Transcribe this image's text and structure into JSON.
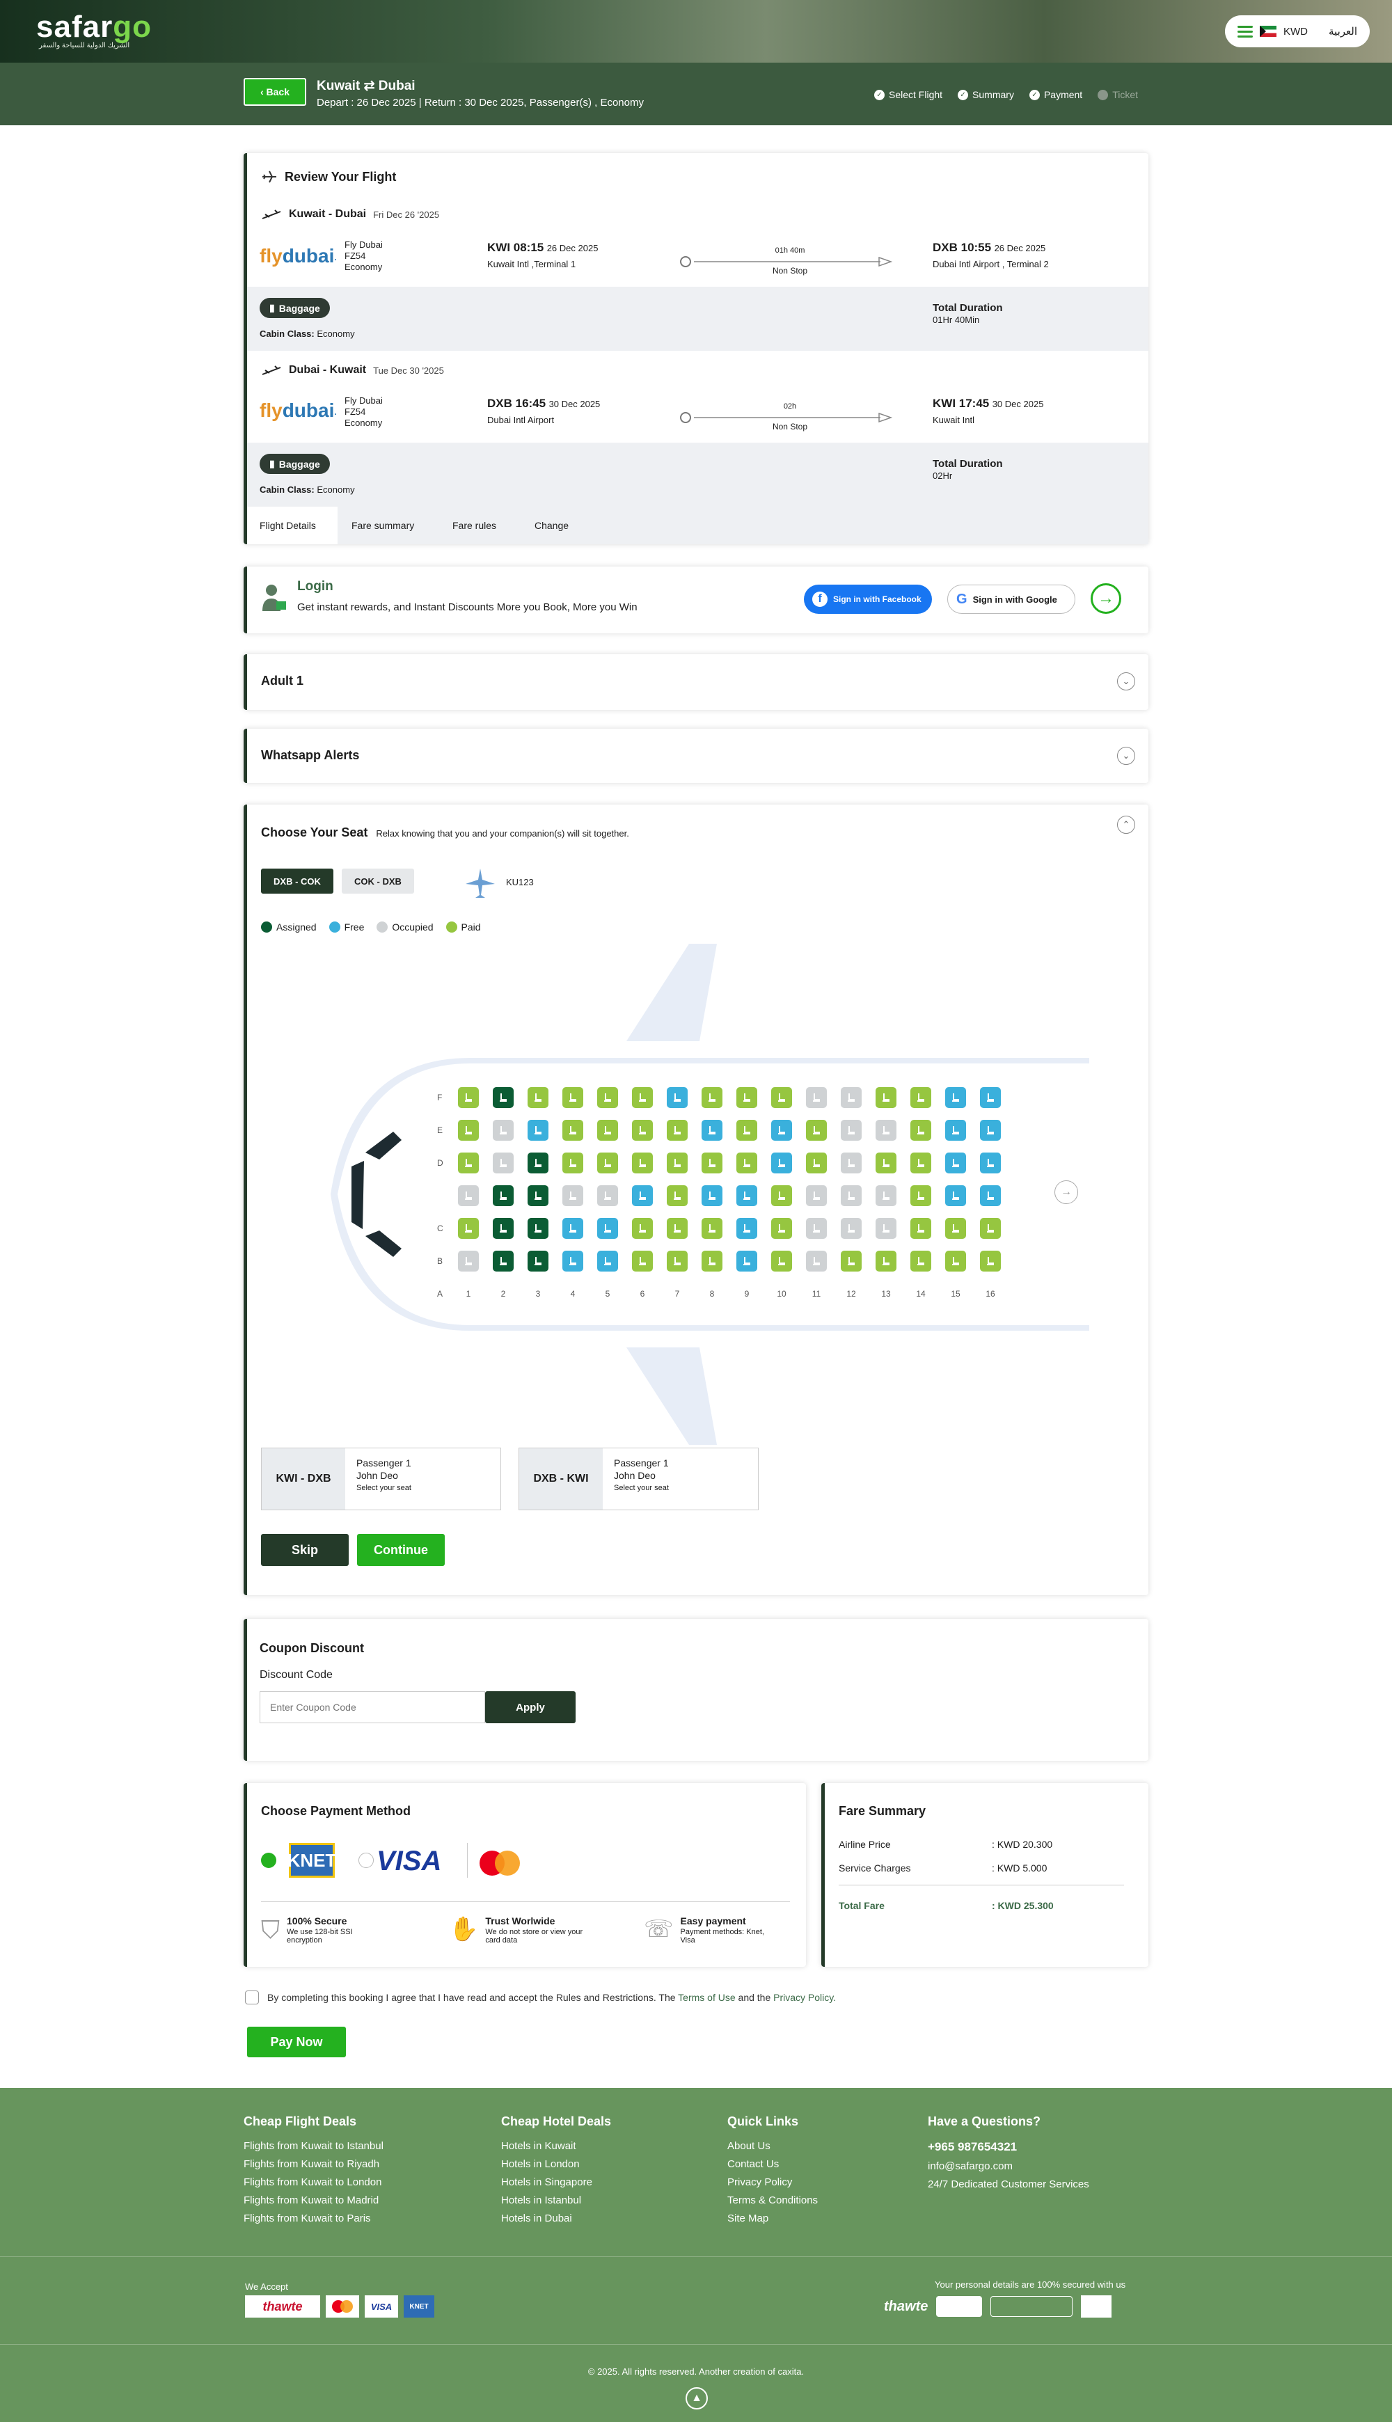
{
  "header": {
    "logo_text": "safargo",
    "logo_sub": "الشريك الدولية للسياحة والسفر",
    "currency": "KWD",
    "language": "العربية"
  },
  "trip": {
    "back": "‹ Back",
    "from": "Kuwait",
    "to": "Dubai",
    "swap_icon": "⇄",
    "details": "Depart : 26 Dec 2025 | Return : 30 Dec 2025, Passenger(s) , Economy"
  },
  "steps": [
    {
      "label": "Select Flight"
    },
    {
      "label": "Summary"
    },
    {
      "label": "Payment"
    },
    {
      "label": "Ticket"
    }
  ],
  "review": {
    "title": "Review Your Flight",
    "legs": [
      {
        "route": "Kuwait - Dubai",
        "date": "Fri Dec 26 '2025",
        "airline_logo": "flydubai",
        "airline": "Fly Dubai",
        "flight": "FZ54",
        "class": "Economy",
        "dep_time": "KWI 08:15",
        "dep_date": "26 Dec 2025",
        "dep_airport": "Kuwait Intl ,Terminal 1",
        "duration": "01h 40m",
        "stops": "Non Stop",
        "arr_time": "DXB 10:55",
        "arr_date": "26 Dec 2025",
        "arr_airport": "Dubai Intl Airport , Terminal 2",
        "baggage": "Baggage",
        "cabin_label": "Cabin Class:",
        "cabin": "Economy",
        "total_label": "Total Duration",
        "total": "01Hr 40Min"
      },
      {
        "route": "Dubai - Kuwait",
        "date": "Tue Dec 30 '2025",
        "airline_logo": "flydubai",
        "airline": "Fly Dubai",
        "flight": "FZ54",
        "class": "Economy",
        "dep_time": "DXB 16:45",
        "dep_date": "30 Dec 2025",
        "dep_airport": "Dubai Intl Airport",
        "duration": "02h",
        "stops": "Non Stop",
        "arr_time": "KWI 17:45",
        "arr_date": "30 Dec 2025",
        "arr_airport": "Kuwait Intl",
        "baggage": "Baggage",
        "cabin_label": "Cabin Class:",
        "cabin": "Economy",
        "total_label": "Total Duration",
        "total": "02Hr"
      }
    ],
    "tabs": [
      "Flight Details",
      "Fare summary",
      "Fare rules",
      "Change"
    ]
  },
  "login": {
    "title": "Login",
    "text": "Get instant rewards, and Instant Discounts More you Book, More you Win",
    "facebook": "Sign in with Facebook",
    "google": "Sign in with Google"
  },
  "adult": {
    "title": "Adult 1"
  },
  "whatsapp": {
    "title": "Whatsapp Alerts"
  },
  "seat": {
    "title": "Choose Your Seat",
    "subtitle": "Relax knowing that you and your companion(s) will sit together.",
    "tabs": [
      "DXB - COK",
      "COK - DXB"
    ],
    "aircraft": "KU123",
    "legend": [
      {
        "label": "Assigned",
        "color": "#0b5c34"
      },
      {
        "label": "Free",
        "color": "#3ab0dc"
      },
      {
        "label": "Occupied",
        "color": "#cfd2d4"
      },
      {
        "label": "Paid",
        "color": "#96c640"
      }
    ],
    "row_labels": [
      "F",
      "E",
      "D",
      "",
      "C",
      "B",
      "A"
    ],
    "columns": [
      "1",
      "2",
      "3",
      "4",
      "5",
      "6",
      "7",
      "8",
      "9",
      "10",
      "11",
      "12",
      "13",
      "14",
      "15",
      "16"
    ],
    "rows": [
      "pappppfpppooppff",
      "pofppppfpfpoopff",
      "poappppppfpoppff",
      "oaaoofpffpooopff",
      "paaffpppfpooopgp",
      "oaaffpppfpopppgp"
    ],
    "passengers": [
      {
        "route": "KWI - DXB",
        "label": "Passenger 1",
        "name": "John Deo",
        "action": "Select your seat"
      },
      {
        "route": "DXB - KWI",
        "label": "Passenger 1",
        "name": "John Deo",
        "action": "Select your seat"
      }
    ],
    "skip": "Skip",
    "continue": "Continue"
  },
  "coupon": {
    "title": "Coupon Discount",
    "label": "Discount Code",
    "placeholder": "Enter Coupon Code",
    "apply": "Apply"
  },
  "payment": {
    "title": "Choose Payment Method",
    "knet": "KNET",
    "visa": "VISA",
    "features": [
      {
        "title": "100% Secure",
        "text": "We use 128-bit SSI encryption"
      },
      {
        "title": "Trust Worlwide",
        "text": "We do not store or view your card data"
      },
      {
        "title": "Easy payment",
        "text": "Payment methods: Knet, Visa"
      }
    ]
  },
  "fare": {
    "title": "Fare Summary",
    "rows": [
      {
        "label": "Airline Price",
        "value": ": KWD 20.300"
      },
      {
        "label": "Service Charges",
        "value": ": KWD 5.000"
      }
    ],
    "total_label": "Total Fare",
    "total": ": KWD 25.300"
  },
  "agree": {
    "text": "By completing this booking I agree that I have read and accept the Rules and Restrictions. The",
    "terms": "Terms of Use",
    "and": "and the",
    "privacy": "Privacy Policy."
  },
  "pay": "Pay Now",
  "footer": {
    "cols": [
      {
        "title": "Cheap Flight Deals",
        "items": [
          "Flights from Kuwait to Istanbul",
          "Flights from Kuwait to Riyadh",
          "Flights from Kuwait to London",
          "Flights from Kuwait to Madrid",
          "Flights from Kuwait to Paris"
        ]
      },
      {
        "title": "Cheap Hotel Deals",
        "items": [
          "Hotels in Kuwait",
          "Hotels in London",
          "Hotels in Singapore",
          "Hotels in Istanbul",
          "Hotels in Dubai"
        ]
      },
      {
        "title": "Quick Links",
        "items": [
          "About Us",
          "Contact Us",
          "Privacy Policy",
          "Terms & Conditions",
          "Site Map"
        ]
      },
      {
        "title": "Have a Questions?",
        "items": [
          "+965 987654321",
          "info@safargo.com",
          "24/7 Dedicated Customer Services"
        ]
      }
    ],
    "we_accept": "We Accept",
    "secured": "Your personal details are 100% secured with us",
    "thawte": "thawte",
    "copyright": "© 2025. All rights reserved. Another creation of caxita."
  },
  "colors": {
    "green": "#24b11f",
    "dark": "#243a29",
    "footer": "#67955d",
    "assigned": "#0b5c34",
    "free": "#3ab0dc",
    "occupied": "#cfd2d4",
    "paid": "#96c640"
  }
}
